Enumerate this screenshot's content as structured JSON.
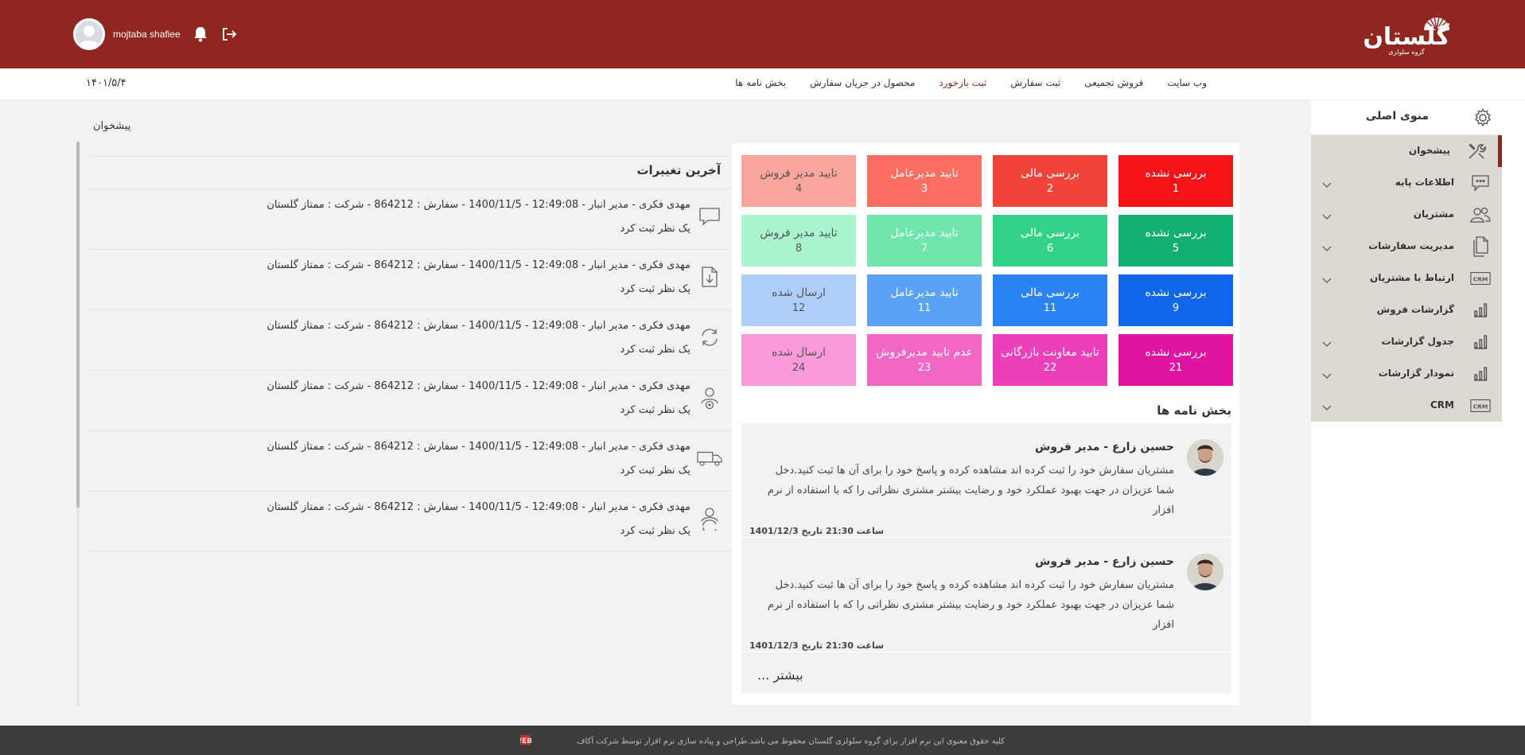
{
  "header": {
    "username": "mojtaba shafiee",
    "logo_text": "گلستان",
    "logo_sub": "گروه سلولزی"
  },
  "nav": {
    "date": "۱۴۰۱/۵/۴",
    "items": [
      {
        "label": "وب سایت",
        "active": false
      },
      {
        "label": "فروش تجمیعی",
        "active": false
      },
      {
        "label": "ثبت سفارش",
        "active": false
      },
      {
        "label": "ثبت بازخورد",
        "active": true
      },
      {
        "label": "محصول در جریان سفارش",
        "active": false
      },
      {
        "label": "بخش نامه ها",
        "active": false
      }
    ]
  },
  "breadcrumb": "پیشخوان",
  "changes": {
    "title": "آخرین تغییرات",
    "items": [
      {
        "icon": "comment-icon",
        "line1": "مهدی فکری - مدیر انبار - 12:49:08 - 1400/11/5 - سفارش : 864212 - شرکت : ممتاز گلستان",
        "line2": "یک نظر ثبت کرد"
      },
      {
        "icon": "download-doc-icon",
        "line1": "مهدی فکری - مدیر انبار - 12:49:08 - 1400/11/5 - سفارش : 864212 - شرکت : ممتاز گلستان",
        "line2": "یک نظر ثبت کرد"
      },
      {
        "icon": "refresh-icon",
        "line1": "مهدی فکری - مدیر انبار - 12:49:08 - 1400/11/5 - سفارش : 864212 - شرکت : ممتاز گلستان",
        "line2": "یک نظر ثبت کرد"
      },
      {
        "icon": "user-add-icon",
        "line1": "مهدی فکری - مدیر انبار - 12:49:08 - 1400/11/5 - سفارش : 864212 - شرکت : ممتاز گلستان",
        "line2": "یک نظر ثبت کرد"
      },
      {
        "icon": "truck-icon",
        "line1": "مهدی فکری - مدیر انبار - 12:49:08 - 1400/11/5 - سفارش : 864212 - شرکت : ممتاز گلستان",
        "line2": "یک نظر ثبت کرد"
      },
      {
        "icon": "user-sync-icon",
        "line1": "مهدی فکری - مدیر انبار - 12:49:08 - 1400/11/5 - سفارش : 864212 - شرکت : ممتاز گلستان",
        "line2": "یک نظر ثبت کرد"
      }
    ]
  },
  "tiles": [
    {
      "label": "بررسی نشده",
      "count": "1",
      "color": "#f5131a",
      "light": false
    },
    {
      "label": "بررسی مالی",
      "count": "2",
      "color": "#f0443a",
      "light": false
    },
    {
      "label": "تایید مدیرعامل",
      "count": "3",
      "color": "#fb6f62",
      "light": false
    },
    {
      "label": "تایید مدیر فروش",
      "count": "4",
      "color": "#fba69c",
      "light": true
    },
    {
      "label": "بررسی نشده",
      "count": "5",
      "color": "#12b070",
      "light": false
    },
    {
      "label": "بررسی مالی",
      "count": "6",
      "color": "#33d18a",
      "light": false
    },
    {
      "label": "تایید مدیرعامل",
      "count": "7",
      "color": "#6ee6ad",
      "light": false
    },
    {
      "label": "تایید مدیر فروش",
      "count": "8",
      "color": "#a9f3cf",
      "light": true
    },
    {
      "label": "بررسی نشده",
      "count": "9",
      "color": "#0d67e8",
      "light": false
    },
    {
      "label": "بررسی مالی",
      "count": "11",
      "color": "#2b83f3",
      "light": false
    },
    {
      "label": "تایید مدیرعامل",
      "count": "11",
      "color": "#5aa2f5",
      "light": false
    },
    {
      "label": "ارسال شده",
      "count": "12",
      "color": "#aecffc",
      "light": true
    },
    {
      "label": "بررسی نشده",
      "count": "21",
      "color": "#e014a3",
      "light": false
    },
    {
      "label": "تایید معاونت بازرگانی",
      "count": "22",
      "color": "#ec3fb8",
      "light": false
    },
    {
      "label": "عدم تایید مدیرفروش",
      "count": "23",
      "color": "#f266c4",
      "light": false
    },
    {
      "label": "ارسال شده",
      "count": "24",
      "color": "#f99bd8",
      "light": true
    }
  ],
  "letters": {
    "title": "بخش نامه ها",
    "items": [
      {
        "name": "حسین زارع - مدیر فروش",
        "text": "مشتریان سفارش خود را ثبت کرده اند مشاهده کرده و پاسخ خود را برای آن ها ثبت کنید.دخل شما عزیزان در جهت بهبود عملکرد خود و رضایت بیشتر مشتری نظراتی را که با استفاده از نرم افزار",
        "time": "ساعت 21:30 تاریخ 1401/12/3"
      },
      {
        "name": "حسین زارع - مدیر فروش",
        "text": "مشتریان سفارش خود را ثبت کرده اند مشاهده کرده و پاسخ خود را برای آن ها ثبت کنید.دخل شما عزیزان در جهت بهبود عملکرد خود و رضایت بیشتر مشتری نظراتی را که با استفاده از نرم افزار",
        "time": "ساعت 21:30 تاریخ 1401/12/3"
      }
    ],
    "more": "بیشتر ..."
  },
  "sidebar": {
    "title": "منوی اصلی",
    "items": [
      {
        "label": "پیشخوان",
        "icon": "tools-icon",
        "active": true,
        "has_children": false
      },
      {
        "label": "اطلاعات پایه",
        "icon": "chat-dots-icon",
        "active": false,
        "has_children": true
      },
      {
        "label": "مشتریان",
        "icon": "users-icon",
        "active": false,
        "has_children": true
      },
      {
        "label": "مدیریت سفارشات",
        "icon": "documents-icon",
        "active": false,
        "has_children": true
      },
      {
        "label": "ارتباط با مشتریان",
        "icon": "crm-icon",
        "active": false,
        "has_children": true
      },
      {
        "label": "گزارشات فروش",
        "icon": "bar-chart-icon",
        "active": false,
        "has_children": false
      },
      {
        "label": "جدول گزارشات",
        "icon": "bar-chart-icon",
        "active": false,
        "has_children": true
      },
      {
        "label": "نمودار گزارشات",
        "icon": "bar-chart-icon",
        "active": false,
        "has_children": true
      },
      {
        "label": "CRM",
        "icon": "crm-icon",
        "active": false,
        "has_children": true
      }
    ]
  },
  "footer": {
    "text": "کلیه حقوق معنوی این نرم افزار برای گروه سلولزی گلستان محفوظ می باشد.طراحی و پیاده سازی نرم افزار توسط شرکت آکاف",
    "logo_text": "AKAFWEB"
  }
}
